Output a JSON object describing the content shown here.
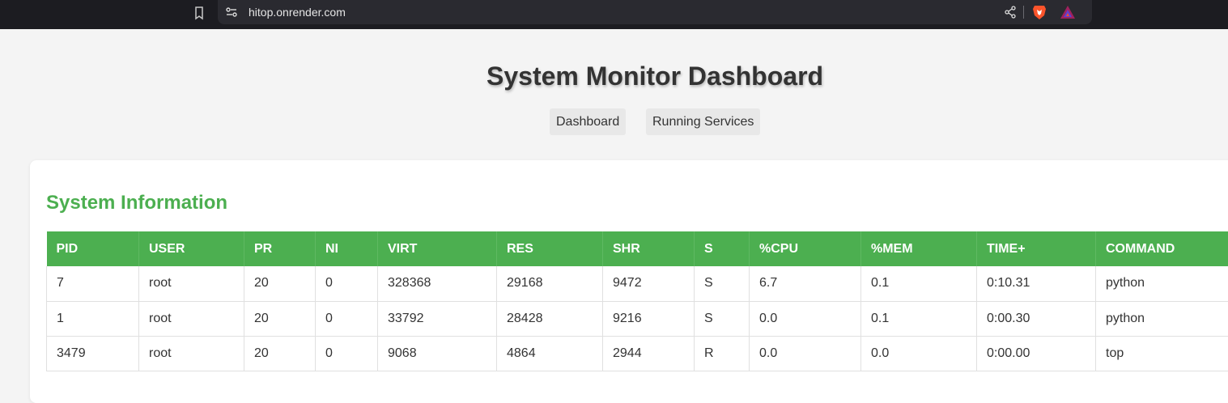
{
  "browser": {
    "url": "hitop.onrender.com"
  },
  "page": {
    "title": "System Monitor Dashboard",
    "nav": [
      {
        "label": "Dashboard"
      },
      {
        "label": "Running Services"
      }
    ]
  },
  "system_info": {
    "title": "System Information",
    "columns": [
      "PID",
      "USER",
      "PR",
      "NI",
      "VIRT",
      "RES",
      "SHR",
      "S",
      "%CPU",
      "%MEM",
      "TIME+",
      "COMMAND"
    ],
    "rows": [
      [
        "7",
        "root",
        "20",
        "0",
        "328368",
        "29168",
        "9472",
        "S",
        "6.7",
        "0.1",
        "0:10.31",
        "python"
      ],
      [
        "1",
        "root",
        "20",
        "0",
        "33792",
        "28428",
        "9216",
        "S",
        "0.0",
        "0.1",
        "0:00.30",
        "python"
      ],
      [
        "3479",
        "root",
        "20",
        "0",
        "9068",
        "4864",
        "2944",
        "R",
        "0.0",
        "0.0",
        "0:00.00",
        "top"
      ]
    ]
  },
  "colors": {
    "accent": "#4caf50",
    "background": "#f4f4f4"
  }
}
